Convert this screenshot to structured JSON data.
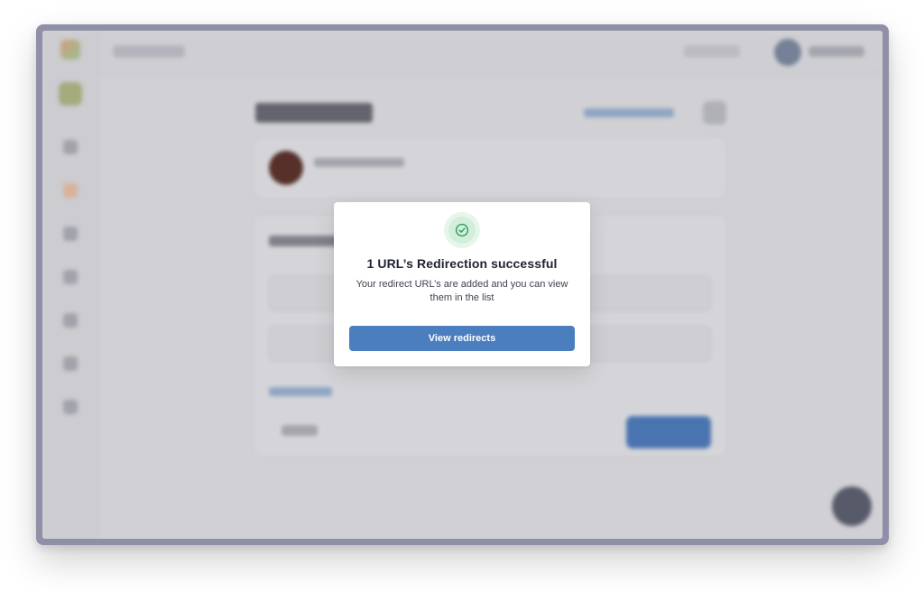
{
  "modal": {
    "icon": "check-circle-icon",
    "title": "1 URL’s Redirection successful",
    "message": "Your redirect URL’s are added and you can view them in the list",
    "primary_button_label": "View redirects"
  },
  "colors": {
    "frame": "#8f8fa8",
    "accent": "#4a7ebf",
    "success": "#2e9e55",
    "success_bg": "#e6f6ea"
  }
}
